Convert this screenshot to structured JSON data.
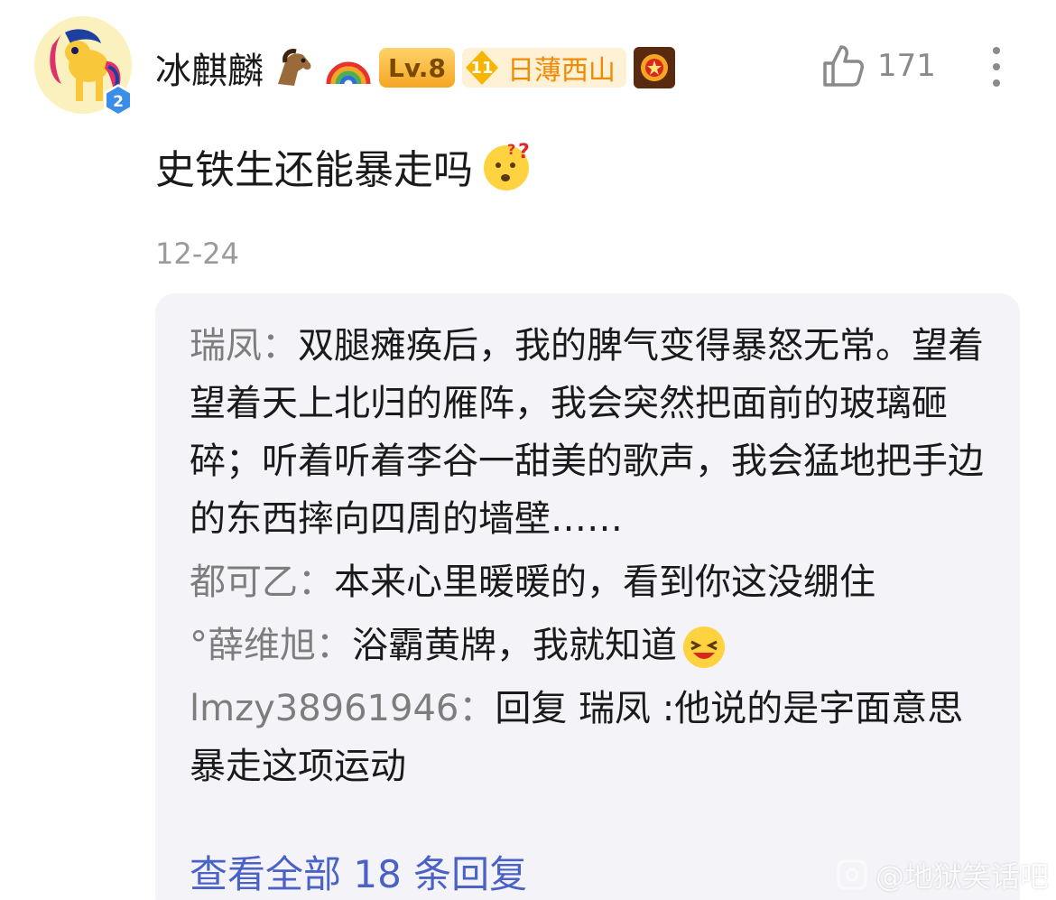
{
  "user": {
    "name": "冰麒麟",
    "avatar_level": "2",
    "level": "Lv.8",
    "fan_level": "11",
    "fan_club": "日薄西山"
  },
  "likes": "171",
  "comment": {
    "text": "史铁生还能暴走吗"
  },
  "date": "12-24",
  "replies": [
    {
      "author": "瑞凤",
      "sep": "：",
      "text": "双腿瘫痪后，我的脾气变得暴怒无常。望着望着天上北归的雁阵，我会突然把面前的玻璃砸碎；听着听着李谷一甜美的歌声，我会猛地把手边的东西摔向四周的墙壁……"
    },
    {
      "author": "都可乙",
      "sep": "：",
      "text": "本来心里暖暖的，看到你这没绷住"
    },
    {
      "author": "°薛维旭",
      "sep": "：",
      "text": "浴霸黄牌，我就知道"
    },
    {
      "author": "lmzy38961946",
      "sep": "：",
      "text": "回复 瑞凤 :他说的是字面意思暴走这项运动"
    }
  ],
  "view_all": "查看全部 18 条回复",
  "watermark": "@地狱笑话吧",
  "colors": {
    "link": "#4a62c8",
    "author": "#7d7d7d",
    "reply_bg": "#f4f4f8",
    "fan_text": "#f08a00"
  },
  "icons": [
    "pony-avatar",
    "level-hex-icon",
    "horse-emoji-icon",
    "rainbow-emoji-icon",
    "fan-diamond-icon",
    "medal-icon",
    "thumbs-up-icon",
    "more-vertical-icon",
    "confused-emoji-icon",
    "laughing-emoji-icon",
    "watermark-logo-icon"
  ]
}
